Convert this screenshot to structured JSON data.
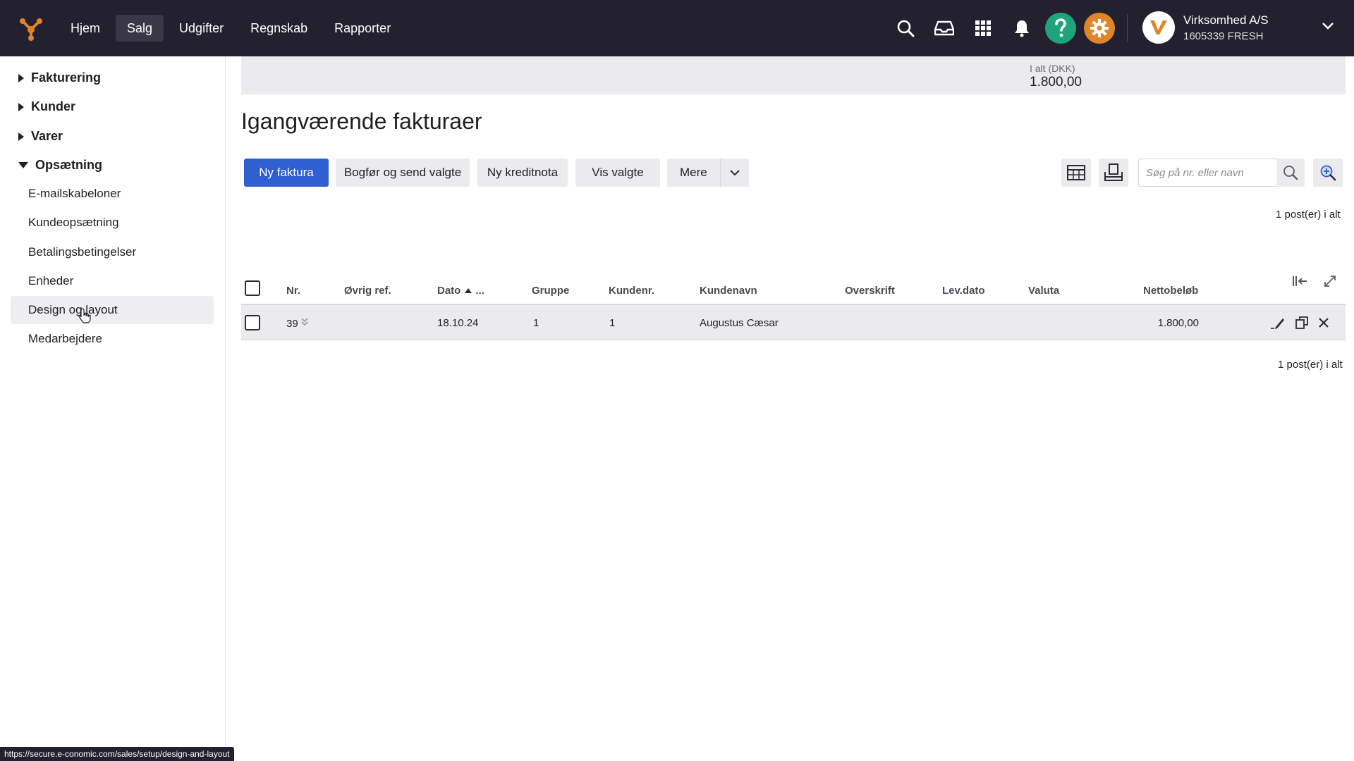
{
  "topnav": {
    "items": [
      {
        "label": "Hjem"
      },
      {
        "label": "Salg"
      },
      {
        "label": "Udgifter"
      },
      {
        "label": "Regnskab"
      },
      {
        "label": "Rapporter"
      }
    ],
    "active": "Salg",
    "icons": [
      "search-icon",
      "inbox-icon",
      "apps-grid-icon",
      "bell-icon",
      "help-icon",
      "settings-icon"
    ],
    "company_name": "Virksomhed A/S",
    "company_sub": "1605339 FRESH"
  },
  "sidebar": {
    "groups": [
      {
        "label": "Fakturering",
        "expanded": false
      },
      {
        "label": "Kunder",
        "expanded": false
      },
      {
        "label": "Varer",
        "expanded": false
      },
      {
        "label": "Opsætning",
        "expanded": true
      }
    ],
    "items": [
      {
        "label": "E-mailskabeloner"
      },
      {
        "label": "Kundeopsætning"
      },
      {
        "label": "Betalingsbetingelser"
      },
      {
        "label": "Enheder"
      },
      {
        "label": "Design og layout"
      },
      {
        "label": "Medarbejdere"
      }
    ],
    "active_item": "Design og layout"
  },
  "totals": {
    "label": "I alt (DKK)",
    "value": "1.800,00"
  },
  "page": {
    "title": "Igangværende fakturaer"
  },
  "toolbar": {
    "new_invoice": "Ny faktura",
    "book_send": "Bogfør og send valgte",
    "new_credit": "Ny kreditnota",
    "show_selected": "Vis valgte",
    "more": "Mere",
    "search_placeholder": "Søg på nr. eller navn"
  },
  "count_top": "1 post(er) i alt",
  "count_bottom": "1 post(er) i alt",
  "table": {
    "headers": {
      "nr": "Nr.",
      "ref": "Øvrig ref.",
      "date": "Dato",
      "date_extra": "...",
      "group": "Gruppe",
      "customer_no": "Kundenr.",
      "customer_name": "Kundenavn",
      "heading": "Overskrift",
      "delivery_date": "Lev.dato",
      "currency": "Valuta",
      "net_amount": "Nettobeløb"
    },
    "rows": [
      {
        "nr": "39",
        "ref": "",
        "date": "18.10.24",
        "group": "1",
        "customer_no": "1",
        "customer_name": "Augustus Cæsar",
        "heading": "",
        "delivery_date": "",
        "currency": "",
        "net_amount": "1.800,00"
      }
    ]
  },
  "statusbar": {
    "url": "https://secure.e-conomic.com/sales/setup/design-and-layout"
  },
  "colors": {
    "topbar": "#23202f",
    "primary": "#2f5fd0",
    "help": "#1fa37a",
    "settings": "#e0862a"
  }
}
